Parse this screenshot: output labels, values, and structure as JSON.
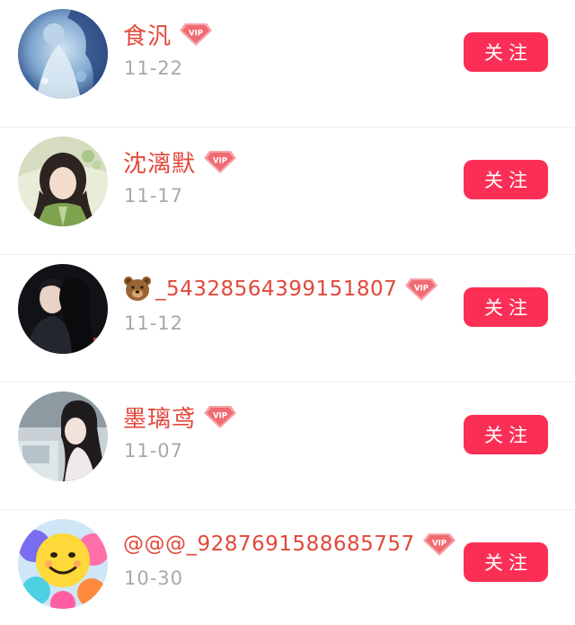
{
  "users": [
    {
      "name": "食汎",
      "date": "11-22",
      "vip_label": "VIP",
      "follow_label": "关注"
    },
    {
      "name": "沈漓默",
      "date": "11-17",
      "vip_label": "VIP",
      "follow_label": "关注"
    },
    {
      "name": "_54328564399151807",
      "date": "11-12",
      "vip_label": "VIP",
      "follow_label": "关注",
      "prefix_icon": "bear-face-emoji"
    },
    {
      "name": "墨璃鸢",
      "date": "11-07",
      "vip_label": "VIP",
      "follow_label": "关注"
    },
    {
      "name": "@@@_9287691588685757",
      "date": "10-30",
      "vip_label": "VIP",
      "follow_label": "关注"
    }
  ],
  "colors": {
    "username": "#e2483a",
    "date": "#a8a8a8",
    "follow_button": "#fb2f55",
    "vip_badge": "#f06a72",
    "divider": "#eeeeee"
  }
}
